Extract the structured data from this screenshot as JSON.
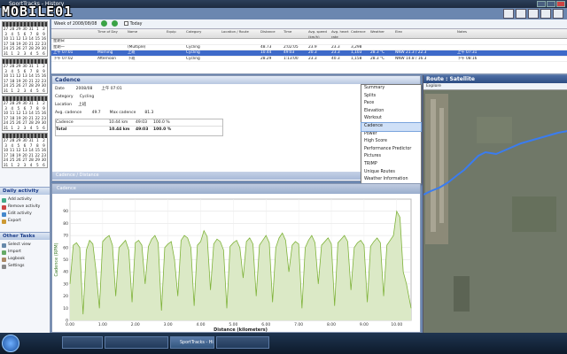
{
  "app": {
    "title": "SportTracks - History",
    "brand": "MOBILE01"
  },
  "toolbar": {
    "week_label": "Week of 2008/08/08",
    "today_label": "Today"
  },
  "calendar_days": [
    [
      "27",
      "28",
      "29",
      "30",
      "31",
      "1",
      "2"
    ],
    [
      "3",
      "4",
      "5",
      "6",
      "7",
      "8",
      "9"
    ],
    [
      "10",
      "11",
      "12",
      "13",
      "14",
      "15",
      "16"
    ],
    [
      "17",
      "18",
      "19",
      "20",
      "21",
      "22",
      "23"
    ],
    [
      "24",
      "25",
      "26",
      "27",
      "28",
      "29",
      "30"
    ],
    [
      "31",
      "1",
      "2",
      "3",
      "4",
      "5",
      "6"
    ]
  ],
  "sidebar": {
    "daily_title": "Daily activity",
    "daily_items": [
      "Add activity",
      "Remove activity",
      "Edit activity",
      "Export"
    ],
    "other_title": "Other Tasks",
    "other_items": [
      "Select view",
      "Import",
      "Logbook",
      "Settings"
    ]
  },
  "table": {
    "headers": [
      "",
      "Time of Day",
      "Name",
      "Equip",
      "Category",
      "Location / Route",
      "Distance",
      "Time",
      "Avg. speed (km/h)",
      "Avg. heart rate",
      "Cadence",
      "Weather",
      "Elev",
      "Notes"
    ],
    "rows": [
      [
        "星期日",
        "",
        "",
        "",
        "",
        "",
        "",
        "",
        "",
        "",
        "",
        "",
        "",
        ""
      ],
      [
        "星期一",
        "",
        "(Multiple)",
        "",
        "Cycling",
        "",
        "48.73",
        "2:02:05",
        "23.9",
        "23.3",
        "3,298",
        "",
        "",
        ""
      ],
      [
        "上午 07:01",
        "Morning",
        "上班",
        "",
        "Cycling",
        "",
        "10.44",
        "49:03",
        "20.3",
        "23.3",
        "1,103",
        "28.3 °C",
        "NNW 21.3 / 22.3",
        "上午 07:31"
      ],
      [
        "下午 07:02",
        "Afternoon",
        "下班",
        "",
        "Cycling",
        "",
        "28.29",
        "1:13:00",
        "23.3",
        "40.3",
        "1,158",
        "28.3 °C",
        "NNW 14.8 / 16.3",
        "下午 08:16"
      ]
    ]
  },
  "detail": {
    "title": "Cadence",
    "date_label": "Date",
    "date_value": "2008/08",
    "time_value": "上午 07:01",
    "category_label": "Category",
    "category_value": "Cycling",
    "location_label": "Location",
    "location_value": "上班",
    "avg_label": "Avg. cadence",
    "avg_value": "49.7",
    "max_label": "Max cadence",
    "max_value": "81.3",
    "summary_rows": [
      [
        "Cadence",
        "10.44 km",
        "49:03",
        "100.0 %"
      ],
      [
        "Total",
        "10.44 km",
        "49:03",
        "100.0 %"
      ]
    ]
  },
  "menu": {
    "items": [
      "Summary",
      "Splits",
      "Pace",
      "Elevation",
      "Workout",
      "Cadence",
      "Power",
      "High Score",
      "Performance Predictor",
      "Pictures",
      "TRIMP",
      "Unique Routes",
      "Weather Information"
    ],
    "highlighted": "Cadence"
  },
  "route": {
    "title": "Route : Satellite",
    "search_label": "Explore"
  },
  "chart": {
    "bar_title": "Cadence / Distance",
    "plot_title": "Cadence",
    "xlabel": "Distance (kilometers)",
    "ylabel": "Cadence (RPM)",
    "color": "#7fb33a"
  },
  "chart_data": {
    "type": "area",
    "title": "Cadence",
    "xlabel": "Distance (kilometers)",
    "ylabel": "Cadence (RPM)",
    "xlim": [
      0,
      10.44
    ],
    "ylim": [
      0,
      100
    ],
    "x_ticks": [
      "0.00",
      "1.00",
      "2.00",
      "3.00",
      "4.00",
      "5.00",
      "6.00",
      "7.00",
      "8.00",
      "9.00",
      "10.00"
    ],
    "y_ticks": [
      "0",
      "10",
      "20",
      "30",
      "40",
      "50",
      "60",
      "70",
      "80",
      "90"
    ],
    "x": [
      0,
      0.1,
      0.2,
      0.3,
      0.4,
      0.5,
      0.6,
      0.7,
      0.8,
      0.9,
      1.0,
      1.1,
      1.2,
      1.3,
      1.4,
      1.5,
      1.6,
      1.7,
      1.8,
      1.9,
      2.0,
      2.1,
      2.2,
      2.3,
      2.4,
      2.5,
      2.6,
      2.7,
      2.8,
      2.9,
      3.0,
      3.1,
      3.2,
      3.3,
      3.4,
      3.5,
      3.6,
      3.7,
      3.8,
      3.9,
      4.0,
      4.1,
      4.2,
      4.3,
      4.4,
      4.5,
      4.6,
      4.7,
      4.8,
      4.9,
      5.0,
      5.1,
      5.2,
      5.3,
      5.4,
      5.5,
      5.6,
      5.7,
      5.8,
      5.9,
      6.0,
      6.1,
      6.2,
      6.3,
      6.4,
      6.5,
      6.6,
      6.7,
      6.8,
      6.9,
      7.0,
      7.1,
      7.2,
      7.3,
      7.4,
      7.5,
      7.6,
      7.7,
      7.8,
      7.9,
      8.0,
      8.1,
      8.2,
      8.3,
      8.4,
      8.5,
      8.6,
      8.7,
      8.8,
      8.9,
      9.0,
      9.1,
      9.2,
      9.3,
      9.4,
      9.5,
      9.6,
      9.7,
      9.8,
      9.9,
      10.0,
      10.1,
      10.2,
      10.3,
      10.44
    ],
    "y": [
      30,
      62,
      64,
      60,
      5,
      58,
      66,
      63,
      40,
      10,
      65,
      68,
      70,
      62,
      20,
      60,
      63,
      66,
      58,
      15,
      64,
      66,
      62,
      30,
      61,
      67,
      70,
      64,
      8,
      60,
      63,
      65,
      50,
      20,
      66,
      70,
      68,
      60,
      12,
      62,
      65,
      74,
      69,
      25,
      63,
      67,
      65,
      58,
      10,
      61,
      64,
      66,
      60,
      35,
      65,
      68,
      63,
      20,
      62,
      66,
      70,
      64,
      15,
      60,
      68,
      72,
      66,
      40,
      62,
      65,
      63,
      10,
      60,
      66,
      70,
      64,
      30,
      62,
      65,
      68,
      63,
      12,
      64,
      67,
      70,
      65,
      25,
      60,
      64,
      66,
      62,
      15,
      61,
      65,
      68,
      64,
      20,
      62,
      66,
      70,
      90,
      85,
      40,
      30,
      10,
      5,
      2
    ]
  }
}
